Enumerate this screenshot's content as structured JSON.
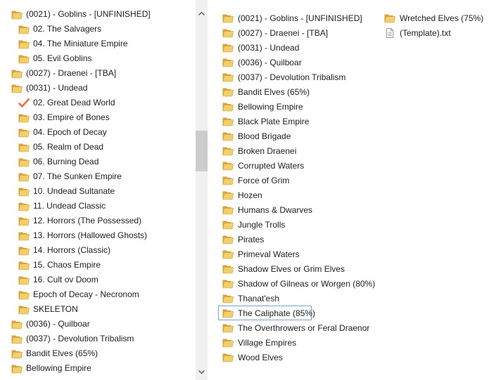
{
  "colors": {
    "folder_back": "#d9a43a",
    "folder_front": "#f2cf6b",
    "check": "#e8703a",
    "focus_border": "#7da2ce",
    "scrollbar_track": "#f0f0f0",
    "scrollbar_thumb": "#cdcdcd"
  },
  "tree": {
    "items": [
      {
        "label": "(0021) - Goblins - [UNFINISHED]",
        "icon": "folder-icon",
        "level": 1
      },
      {
        "label": "02. The Salvagers",
        "icon": "folder-icon",
        "level": 2
      },
      {
        "label": "04. The Miniature Empire",
        "icon": "folder-icon",
        "level": 2
      },
      {
        "label": "05. Evil Goblins",
        "icon": "folder-icon",
        "level": 2
      },
      {
        "label": "(0027) - Draenei - [TBA]",
        "icon": "folder-icon",
        "level": 1
      },
      {
        "label": "(0031) - Undead",
        "icon": "folder-icon",
        "level": 1
      },
      {
        "label": "02. Great Dead World",
        "icon": "checkmark-icon",
        "level": 2
      },
      {
        "label": "03. Empire of Bones",
        "icon": "folder-icon",
        "level": 2
      },
      {
        "label": "04. Epoch of Decay",
        "icon": "folder-icon",
        "level": 2
      },
      {
        "label": "05. Realm of Dead",
        "icon": "folder-icon",
        "level": 2
      },
      {
        "label": "06. Burning Dead",
        "icon": "folder-icon",
        "level": 2
      },
      {
        "label": "07. The Sunken Empire",
        "icon": "folder-icon",
        "level": 2
      },
      {
        "label": "10. Undead Sultanate",
        "icon": "folder-icon",
        "level": 2
      },
      {
        "label": "11. Undead Classic",
        "icon": "folder-icon",
        "level": 2
      },
      {
        "label": "12. Horrors (The Possessed)",
        "icon": "folder-icon",
        "level": 2
      },
      {
        "label": "13. Horrors (Hallowed Ghosts)",
        "icon": "folder-icon",
        "level": 2
      },
      {
        "label": "14. Horrors (Classic)",
        "icon": "folder-icon",
        "level": 2
      },
      {
        "label": "15. Chaos Empire",
        "icon": "folder-icon",
        "level": 2
      },
      {
        "label": "16. Cult ov Doom",
        "icon": "folder-icon",
        "level": 2
      },
      {
        "label": "Epoch of Decay - Necronom",
        "icon": "folder-icon",
        "level": 2
      },
      {
        "label": "SKELETON",
        "icon": "folder-icon",
        "level": 2
      },
      {
        "label": "(0036) - Quilboar",
        "icon": "folder-icon",
        "level": 1
      },
      {
        "label": "(0037) - Devolution Tribalism",
        "icon": "folder-icon",
        "level": 1
      },
      {
        "label": "Bandit Elves (65%)",
        "icon": "folder-icon",
        "level": 1
      },
      {
        "label": "Bellowing Empire",
        "icon": "folder-icon",
        "level": 1
      }
    ]
  },
  "content": {
    "column1": [
      {
        "label": "(0021) - Goblins - [UNFINISHED]",
        "icon": "folder-icon"
      },
      {
        "label": "(0027) - Draenei - [TBA]",
        "icon": "folder-icon"
      },
      {
        "label": "(0031) - Undead",
        "icon": "folder-icon"
      },
      {
        "label": "(0036) - Quilboar",
        "icon": "folder-icon"
      },
      {
        "label": "(0037) - Devolution Tribalism",
        "icon": "folder-icon"
      },
      {
        "label": "Bandit Elves (65%)",
        "icon": "folder-icon"
      },
      {
        "label": "Bellowing Empire",
        "icon": "folder-icon"
      },
      {
        "label": "Black Plate Empire",
        "icon": "folder-icon"
      },
      {
        "label": "Blood Brigade",
        "icon": "folder-icon"
      },
      {
        "label": "Broken Draenei",
        "icon": "folder-icon"
      },
      {
        "label": "Corrupted Waters",
        "icon": "folder-icon"
      },
      {
        "label": "Force of Grim",
        "icon": "folder-icon"
      },
      {
        "label": "Hozen",
        "icon": "folder-icon"
      },
      {
        "label": "Humans & Dwarves",
        "icon": "folder-icon"
      },
      {
        "label": "Jungle Trolls",
        "icon": "folder-icon"
      },
      {
        "label": "Pirates",
        "icon": "folder-icon"
      },
      {
        "label": "Primeval Waters",
        "icon": "folder-icon"
      },
      {
        "label": "Shadow Elves or Grim Elves",
        "icon": "folder-icon"
      },
      {
        "label": "Shadow of Gilneas or Worgen (80%)",
        "icon": "folder-icon"
      },
      {
        "label": "Thanat'esh",
        "icon": "folder-icon"
      },
      {
        "label": "The Caliphate (85%)",
        "icon": "folder-icon",
        "focused": true
      },
      {
        "label": "The Overthrowers or Feral Draenor",
        "icon": "folder-icon"
      },
      {
        "label": "Village Empires",
        "icon": "folder-icon"
      },
      {
        "label": "Wood Elves",
        "icon": "folder-icon"
      }
    ],
    "column2": [
      {
        "label": "Wretched Elves (75%)",
        "icon": "folder-icon"
      },
      {
        "label": "(Template).txt",
        "icon": "text-file-icon"
      }
    ]
  }
}
